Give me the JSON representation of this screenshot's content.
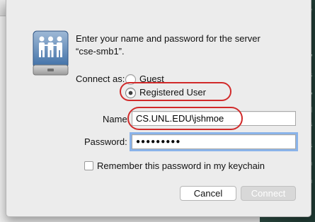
{
  "dialog": {
    "prompt_line1": "Enter your name and password for the server",
    "prompt_line2": "“cse-smb1”.",
    "connect_as_label": "Connect as:",
    "options": [
      {
        "label": "Guest",
        "selected": false
      },
      {
        "label": "Registered User",
        "selected": true
      }
    ],
    "name_label": "Name:",
    "name_value": "CS.UNL.EDU\\jshmoe",
    "password_label": "Password:",
    "password_masked": "●●●●●●●●●",
    "remember_label": "Remember this password in my keychain",
    "remember_checked": false,
    "cancel_label": "Cancel",
    "connect_label": "Connect"
  },
  "background": {
    "strip_chars": [
      "e",
      "w",
      "s",
      "w",
      "d",
      "s",
      "s",
      "n",
      "n"
    ]
  },
  "colors": {
    "annotation_red": "#d12a2a",
    "focus_ring": "#6aa0e8"
  }
}
